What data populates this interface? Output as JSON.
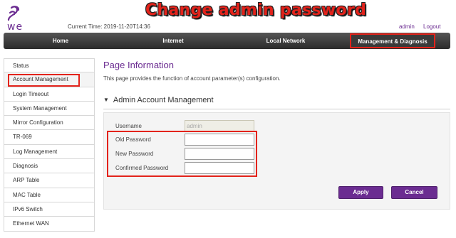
{
  "brand": {
    "logo_text": "we",
    "color": "#6b2c91"
  },
  "overlay_title": "Change admin password",
  "header": {
    "current_time": "Current Time: 2019-11-20T14:36",
    "user": "admin",
    "logout": "Logout"
  },
  "nav": {
    "items": [
      "Home",
      "Internet",
      "Local Network",
      "Management & Diagnosis"
    ],
    "active": "Management & Diagnosis"
  },
  "sidebar": {
    "items": [
      "Status",
      "Account Management",
      "Login Timeout",
      "System Management",
      "Mirror Configuration",
      "TR-069",
      "Log Management",
      "Diagnosis",
      "ARP Table",
      "MAC Table",
      "IPv6 Switch",
      "Ethernet WAN"
    ],
    "active": "Account Management"
  },
  "main": {
    "page_title": "Page Information",
    "page_desc": "This page provides the function of account parameter(s) configuration.",
    "section_title": "Admin Account Management",
    "fields": {
      "username_label": "Username",
      "username_value": "admin",
      "old_password_label": "Old Password",
      "new_password_label": "New Password",
      "confirmed_password_label": "Confirmed Password"
    },
    "buttons": {
      "apply": "Apply",
      "cancel": "Cancel"
    }
  },
  "colors": {
    "accent": "#6b2c91",
    "highlight": "#e3231b",
    "navbar": "#2b2b2b"
  }
}
